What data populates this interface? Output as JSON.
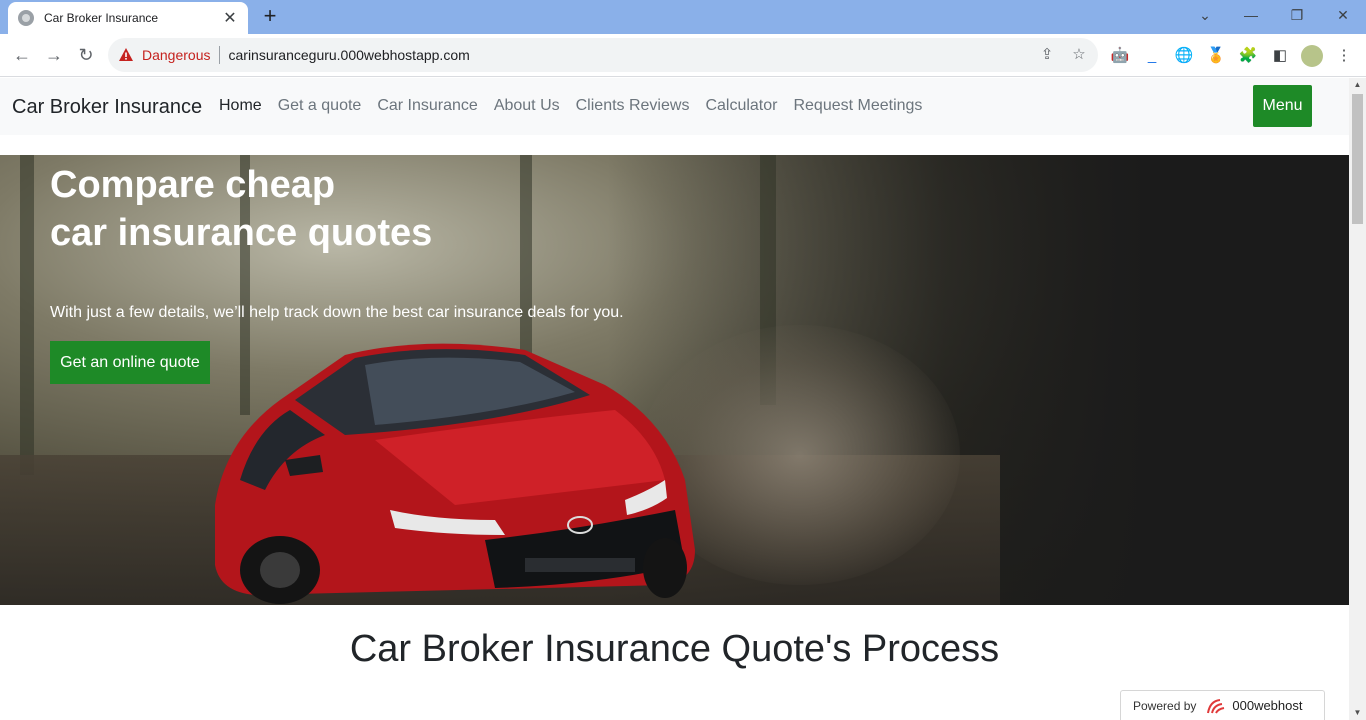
{
  "browser": {
    "tab_title": "Car Broker Insurance",
    "security_label": "Dangerous",
    "url": "carinsuranceguru.000webhostapp.com"
  },
  "navbar": {
    "brand": "Car Broker Insurance",
    "links": [
      "Home",
      "Get a quote",
      "Car Insurance",
      "About Us",
      "Clients Reviews",
      "Calculator",
      "Request Meetings"
    ],
    "menu_label": "Menu"
  },
  "hero": {
    "title_line1": "Compare cheap",
    "title_line2": "car insurance quotes",
    "subtitle": "With just a few details, we’ll help track down the best car insurance deals for you.",
    "cta": "Get an online quote"
  },
  "section": {
    "title": "Car Broker Insurance Quote's Process"
  },
  "footer_badge": {
    "powered_by": "Powered by",
    "brand": "000webhost"
  },
  "colors": {
    "accent_green": "#1e8a27",
    "tabbar_blue": "#8ab0e9",
    "danger_red": "#c5221f"
  }
}
